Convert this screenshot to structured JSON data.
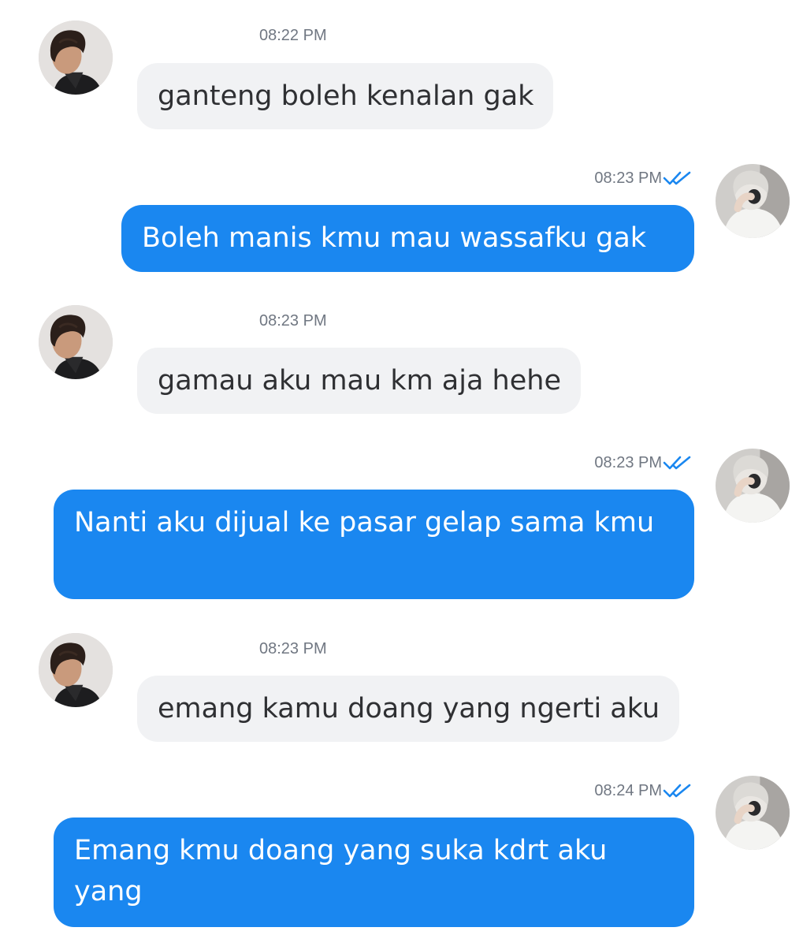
{
  "conversation": {
    "messages": [
      {
        "side": "incoming",
        "time": "08:22 PM",
        "text": "ganteng boleh kenalan gak",
        "avatar": "avatar-dark-hair"
      },
      {
        "side": "outgoing",
        "time": "08:23 PM",
        "text": "Boleh manis kmu mau wassafku gak",
        "avatar": "avatar-silver-hair",
        "status_icon": "double-check-icon"
      },
      {
        "side": "incoming",
        "time": "08:23 PM",
        "text": "gamau aku mau km aja hehe",
        "avatar": "avatar-dark-hair"
      },
      {
        "side": "outgoing",
        "time": "08:23 PM",
        "text": "Nanti aku dijual ke pasar gelap sama kmu",
        "avatar": "avatar-silver-hair",
        "status_icon": "double-check-icon"
      },
      {
        "side": "incoming",
        "time": "08:23 PM",
        "text": "emang kamu doang yang ngerti aku",
        "avatar": "avatar-dark-hair"
      },
      {
        "side": "outgoing",
        "time": "08:24 PM",
        "text": "Emang kmu doang yang suka kdrt aku yang",
        "avatar": "avatar-silver-hair",
        "status_icon": "double-check-icon"
      }
    ]
  },
  "colors": {
    "outgoing_bubble": "#1a87f0",
    "incoming_bubble": "#f1f2f4",
    "read_receipt": "#1a87f0",
    "timestamp": "#707782"
  }
}
